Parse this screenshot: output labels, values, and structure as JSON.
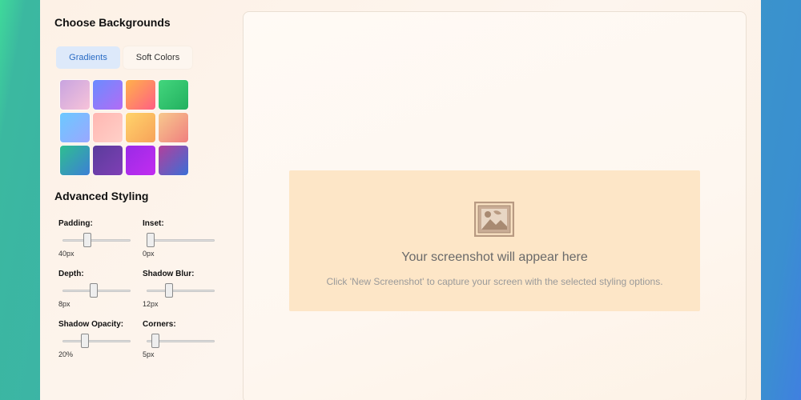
{
  "sidebar": {
    "backgrounds_title": "Choose Backgrounds",
    "tabs": [
      {
        "label": "Gradients",
        "active": true
      },
      {
        "label": "Soft Colors",
        "active": false
      }
    ],
    "swatches": [
      {
        "name": "lavender-pink",
        "from": "#c8a4e0",
        "to": "#f7c3d9"
      },
      {
        "name": "blue-violet",
        "from": "#6a8cff",
        "to": "#b36cf5"
      },
      {
        "name": "orange-pink",
        "from": "#ffb14a",
        "to": "#ff5f84"
      },
      {
        "name": "green",
        "from": "#43d67d",
        "to": "#22b05f"
      },
      {
        "name": "sky-blue",
        "from": "#6bc9ff",
        "to": "#9aa7ff"
      },
      {
        "name": "pink-peach",
        "from": "#ffb7b2",
        "to": "#ffd0c8"
      },
      {
        "name": "yellow-orange",
        "from": "#ffd46a",
        "to": "#f7a25a"
      },
      {
        "name": "peach-rose",
        "from": "#f7c98d",
        "to": "#f07f7f"
      },
      {
        "name": "teal-blue",
        "from": "#2ebf8f",
        "to": "#3d7fd6"
      },
      {
        "name": "deep-purple",
        "from": "#5a3c9c",
        "to": "#7f3fb5"
      },
      {
        "name": "violet",
        "from": "#9a2be6",
        "to": "#c22cf0"
      },
      {
        "name": "purple-blue",
        "from": "#b33f9c",
        "to": "#3b6fd6"
      }
    ],
    "advanced_title": "Advanced Styling",
    "controls": [
      {
        "label": "Padding:",
        "value": "40px",
        "level": 0.35
      },
      {
        "label": "Inset:",
        "value": "0px",
        "level": 0.0
      },
      {
        "label": "Depth:",
        "value": "8px",
        "level": 0.45
      },
      {
        "label": "Shadow Blur:",
        "value": "12px",
        "level": 0.3
      },
      {
        "label": "Shadow Opacity:",
        "value": "20%",
        "level": 0.3
      },
      {
        "label": "Corners:",
        "value": "5px",
        "level": 0.08
      }
    ]
  },
  "preview": {
    "title": "Your screenshot will appear here",
    "subtitle": "Click 'New Screenshot' to capture your screen with the selected styling options.",
    "icon": "framed-picture-icon"
  }
}
